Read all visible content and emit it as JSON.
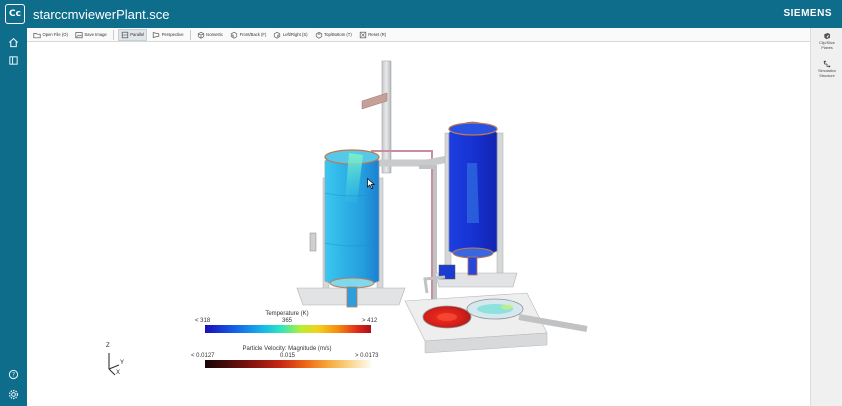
{
  "window": {
    "app_badge": "Cc",
    "title": "starccmviewerPlant.sce",
    "brand": "SIEMENS"
  },
  "left_rail": {
    "icons": [
      "home-icon",
      "book-icon",
      "help-icon",
      "settings-icon"
    ]
  },
  "toolbar": {
    "items": [
      {
        "label": "Open File (O)",
        "icon": "folder-icon"
      },
      {
        "label": "Save Image",
        "icon": "image-icon"
      },
      {
        "label": "Parallel",
        "icon": "parallel-icon",
        "active": true
      },
      {
        "label": "Perspective",
        "icon": "perspective-icon"
      },
      {
        "label": "Isometric",
        "icon": "isometric-icon"
      },
      {
        "label": "Front/Back (F)",
        "icon": "front-back-icon"
      },
      {
        "label": "Left/Right (S)",
        "icon": "left-right-icon"
      },
      {
        "label": "Top/Bottom (T)",
        "icon": "top-bottom-icon"
      },
      {
        "label": "Reset (R)",
        "icon": "reset-icon"
      }
    ]
  },
  "right_panel": {
    "items": [
      {
        "label_line1": "Clip/Slice",
        "label_line2": "Planes",
        "icon": "clip-planes-icon"
      },
      {
        "label_line1": "Simulation",
        "label_line2": "Structure",
        "icon": "simulation-structure-icon"
      }
    ]
  },
  "legends": {
    "temperature": {
      "title": "Temperature (K)",
      "min_label": "< 318",
      "mid_label": "365",
      "max_label": "> 412"
    },
    "velocity": {
      "title": "Particle Velocity: Magnitude (m/s)",
      "min_label": "< 0.0127",
      "mid_label": "0.015",
      "max_label": "> 0.0173"
    }
  },
  "axes": {
    "z": "Z",
    "y": "Y",
    "x": "X"
  },
  "colors": {
    "chrome_teal": "#0f6d8c",
    "viewport_bg": "#ffffff",
    "tank_left_fluid": "#2fb5e6",
    "tank_right_fluid": "#1838d8",
    "hot_fluid": "#e02a1a"
  }
}
